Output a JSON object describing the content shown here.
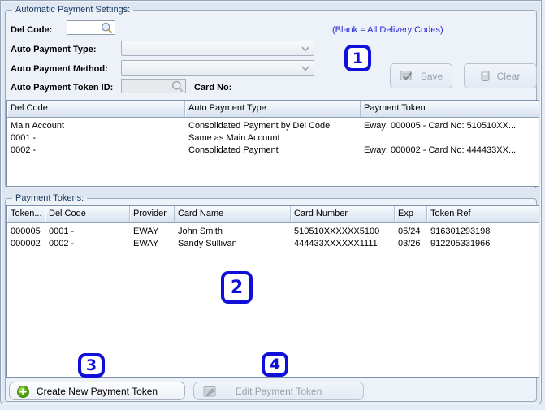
{
  "colors": {
    "annotation_blue": "#0f0fd9",
    "hint_blue": "#2727cf",
    "legend_navy": "#17375e",
    "panel_bg": "#dde6f1"
  },
  "icons": {
    "del_code_lookup": "search-icon",
    "token_id_lookup": "search-icon",
    "save": "save-check-icon",
    "clear": "clear-bin-icon",
    "create": "green-plus-icon",
    "edit": "edit-pencil-icon",
    "combo": "chevron-down-icon"
  },
  "auto_settings": {
    "legend": "Automatic Payment Settings:",
    "del_code_label": "Del Code:",
    "del_code_value": "",
    "hint": "(Blank = All Delivery Codes)",
    "auto_payment_type_label": "Auto Payment Type:",
    "auto_payment_type_value": "",
    "auto_payment_method_label": "Auto Payment Method:",
    "auto_payment_method_value": "",
    "auto_payment_token_id_label": "Auto Payment Token ID:",
    "auto_payment_token_id_value": "",
    "card_no_label": "Card No:",
    "save_label": "Save",
    "clear_label": "Clear",
    "assignments_table": {
      "columns": [
        "Del Code",
        "Auto Payment Type",
        "Payment Token"
      ],
      "rows": [
        [
          "Main Account",
          "Consolidated Payment by Del Code",
          "Eway: 000005 - Card No: 510510XX..."
        ],
        [
          "0001 -",
          "Same as Main Account",
          ""
        ],
        [
          "0002 -",
          "Consolidated Payment",
          "Eway: 000002 - Card No: 444433XX..."
        ]
      ]
    }
  },
  "payment_tokens": {
    "legend": "Payment Tokens:",
    "table": {
      "columns": [
        "Token...",
        "Del Code",
        "Provider",
        "Card Name",
        "Card Number",
        "Exp",
        "Token Ref"
      ],
      "rows": [
        [
          "000005",
          "0001 -",
          "EWAY",
          "John Smith",
          "510510XXXXXX5100",
          "05/24",
          "916301293198"
        ],
        [
          "000002",
          "0002 -",
          "EWAY",
          "Sandy Sullivan",
          "444433XXXXXX1111",
          "03/26",
          "912205331966"
        ]
      ]
    },
    "create_label": "Create New Payment Token",
    "edit_label": "Edit Payment Token"
  },
  "badges": [
    "1",
    "2",
    "3",
    "4"
  ]
}
